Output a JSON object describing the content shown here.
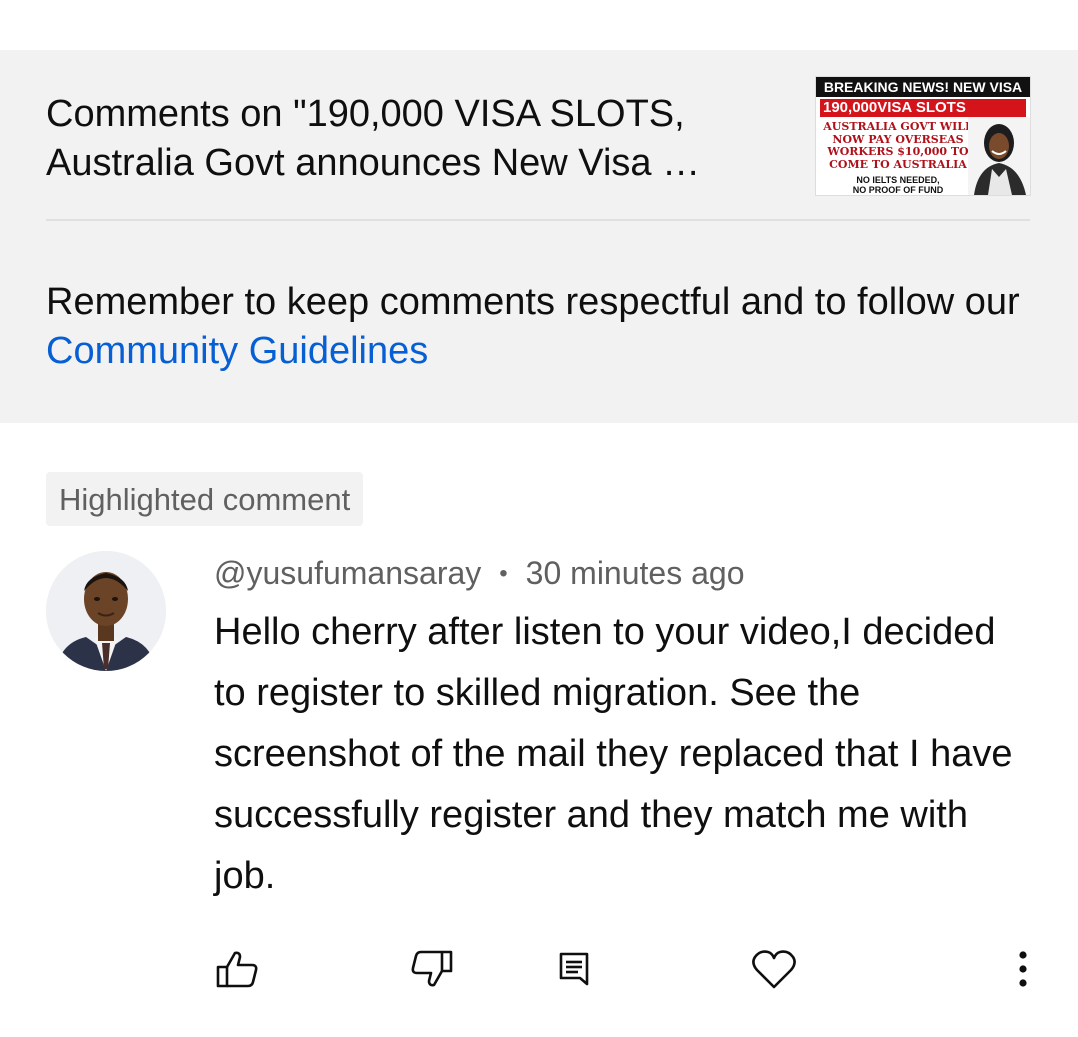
{
  "header": {
    "title_line1": "Comments on \"190,000 VISA SLOTS,",
    "title_line2": "Australia Govt announces New Visa …",
    "thumbnail": {
      "bar": "BREAKING NEWS! NEW VISA",
      "red": "190,000VISA SLOTS",
      "lines": [
        "AUSTRALIA GOVT WILL",
        "NOW PAY OVERSEAS",
        "WORKERS $10,000 TO",
        "COME TO AUSTRALIA"
      ],
      "small": [
        "NO IELTS NEEDED,",
        "NO PROOF OF FUND"
      ]
    }
  },
  "notice": {
    "text": "Remember to keep comments respectful and to follow our ",
    "link": "Community Guidelines"
  },
  "comment": {
    "highlight_label": "Highlighted comment",
    "author": "@yusufumansaray",
    "separator": "•",
    "time": "30 minutes ago",
    "text": "Hello cherry after listen to your video,I decided to register to skilled migration. See the screenshot of the mail they replaced that I have successfully register and they match me with job."
  },
  "actions": {
    "icons": [
      "thumbs-up-icon",
      "thumbs-down-icon",
      "reply-icon",
      "heart-icon",
      "more-vert-icon"
    ]
  },
  "colors": {
    "link": "#065fd4",
    "panel_bg": "#f2f2f2",
    "secondary_text": "#606060"
  }
}
